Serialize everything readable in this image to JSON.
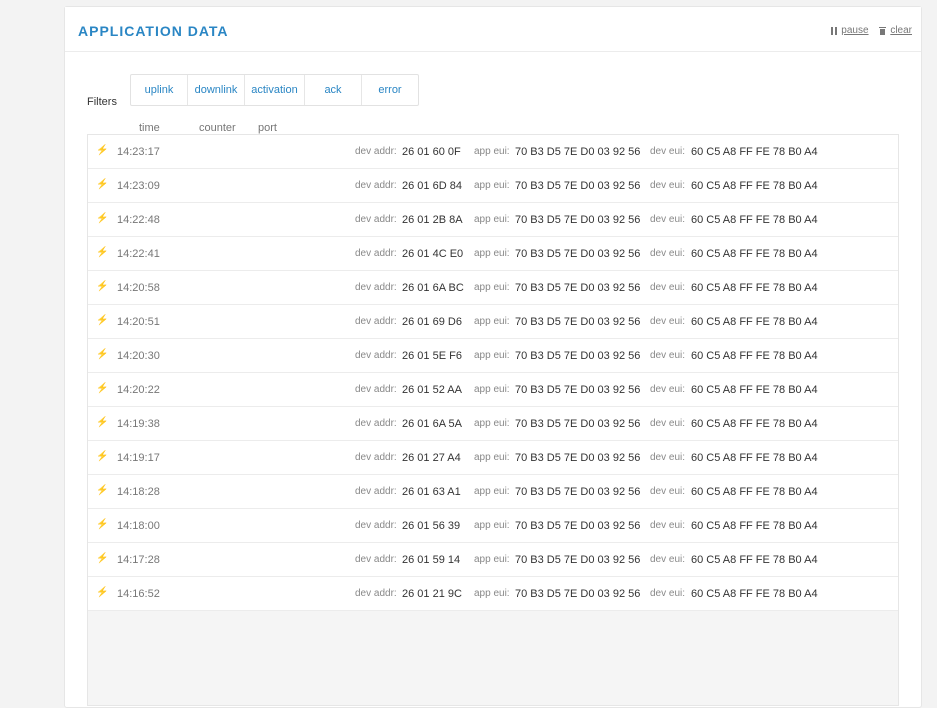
{
  "header": {
    "title": "APPLICATION DATA",
    "pause_label": "pause",
    "clear_label": "clear"
  },
  "filters": {
    "label": "Filters",
    "buttons": [
      "uplink",
      "downlink",
      "activation",
      "ack",
      "error"
    ]
  },
  "columns": {
    "time": "time",
    "counter": "counter",
    "port": "port"
  },
  "field_labels": {
    "dev_addr": "dev addr:",
    "app_eui": "app eui:",
    "dev_eui": "dev eui:"
  },
  "rows": [
    {
      "time": "14:23:17",
      "dev_addr": "26 01 60 0F",
      "app_eui": "70 B3 D5 7E D0 03 92 56",
      "dev_eui": "60 C5 A8 FF FE 78 B0 A4"
    },
    {
      "time": "14:23:09",
      "dev_addr": "26 01 6D 84",
      "app_eui": "70 B3 D5 7E D0 03 92 56",
      "dev_eui": "60 C5 A8 FF FE 78 B0 A4"
    },
    {
      "time": "14:22:48",
      "dev_addr": "26 01 2B 8A",
      "app_eui": "70 B3 D5 7E D0 03 92 56",
      "dev_eui": "60 C5 A8 FF FE 78 B0 A4"
    },
    {
      "time": "14:22:41",
      "dev_addr": "26 01 4C E0",
      "app_eui": "70 B3 D5 7E D0 03 92 56",
      "dev_eui": "60 C5 A8 FF FE 78 B0 A4"
    },
    {
      "time": "14:20:58",
      "dev_addr": "26 01 6A BC",
      "app_eui": "70 B3 D5 7E D0 03 92 56",
      "dev_eui": "60 C5 A8 FF FE 78 B0 A4"
    },
    {
      "time": "14:20:51",
      "dev_addr": "26 01 69 D6",
      "app_eui": "70 B3 D5 7E D0 03 92 56",
      "dev_eui": "60 C5 A8 FF FE 78 B0 A4"
    },
    {
      "time": "14:20:30",
      "dev_addr": "26 01 5E F6",
      "app_eui": "70 B3 D5 7E D0 03 92 56",
      "dev_eui": "60 C5 A8 FF FE 78 B0 A4"
    },
    {
      "time": "14:20:22",
      "dev_addr": "26 01 52 AA",
      "app_eui": "70 B3 D5 7E D0 03 92 56",
      "dev_eui": "60 C5 A8 FF FE 78 B0 A4"
    },
    {
      "time": "14:19:38",
      "dev_addr": "26 01 6A 5A",
      "app_eui": "70 B3 D5 7E D0 03 92 56",
      "dev_eui": "60 C5 A8 FF FE 78 B0 A4"
    },
    {
      "time": "14:19:17",
      "dev_addr": "26 01 27 A4",
      "app_eui": "70 B3 D5 7E D0 03 92 56",
      "dev_eui": "60 C5 A8 FF FE 78 B0 A4"
    },
    {
      "time": "14:18:28",
      "dev_addr": "26 01 63 A1",
      "app_eui": "70 B3 D5 7E D0 03 92 56",
      "dev_eui": "60 C5 A8 FF FE 78 B0 A4"
    },
    {
      "time": "14:18:00",
      "dev_addr": "26 01 56 39",
      "app_eui": "70 B3 D5 7E D0 03 92 56",
      "dev_eui": "60 C5 A8 FF FE 78 B0 A4"
    },
    {
      "time": "14:17:28",
      "dev_addr": "26 01 59 14",
      "app_eui": "70 B3 D5 7E D0 03 92 56",
      "dev_eui": "60 C5 A8 FF FE 78 B0 A4"
    },
    {
      "time": "14:16:52",
      "dev_addr": "26 01 21 9C",
      "app_eui": "70 B3 D5 7E D0 03 92 56",
      "dev_eui": "60 C5 A8 FF FE 78 B0 A4"
    }
  ]
}
